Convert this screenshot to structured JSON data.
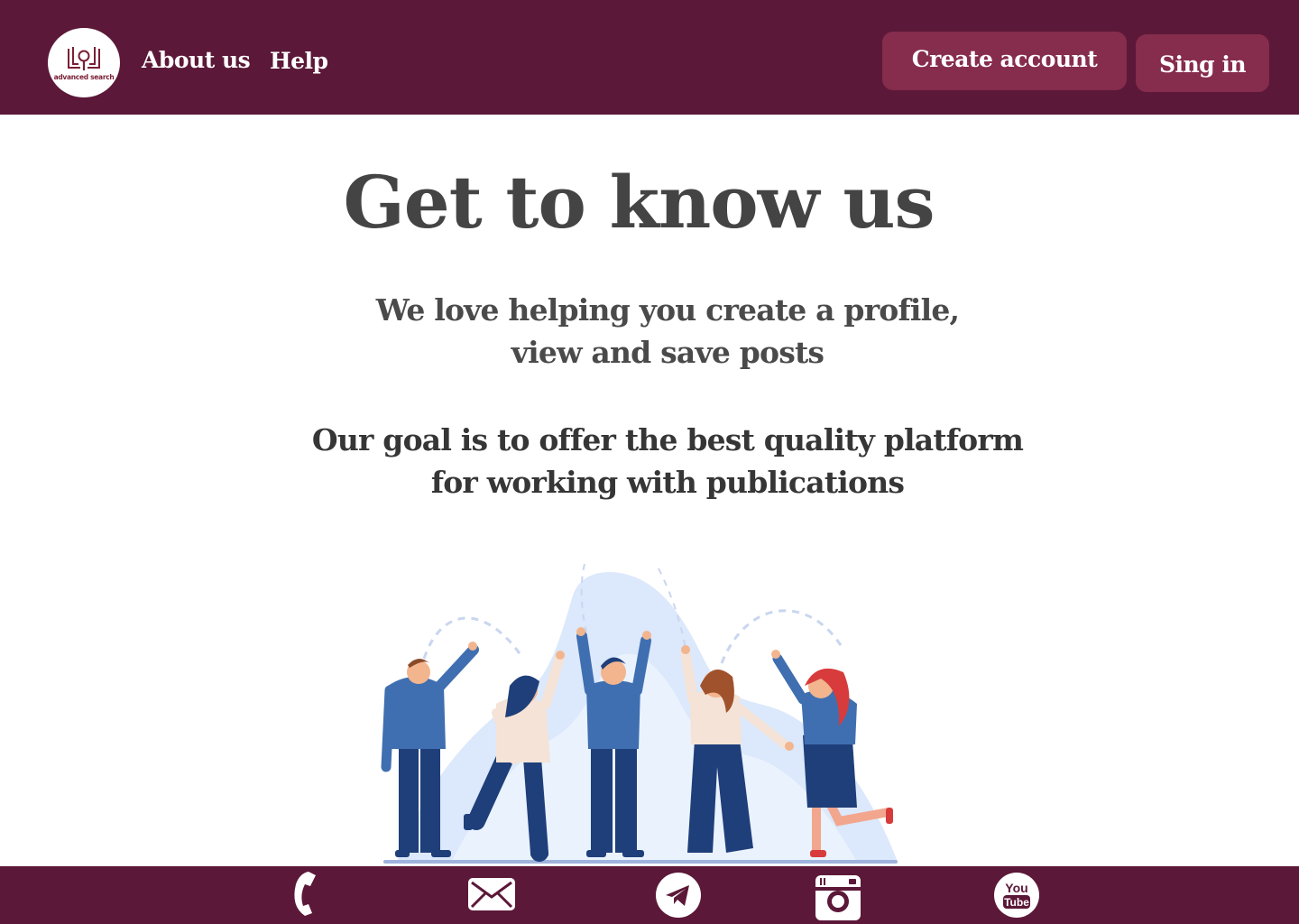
{
  "header": {
    "logo_text": "advanced search",
    "nav": {
      "about_label": "About us",
      "help_label": "Help"
    },
    "create_account_label": "Create account",
    "sign_in_label": "Sing in"
  },
  "main": {
    "title": "Get to know us",
    "paragraph_1": [
      "We love helping you create a profile,",
      "view and save posts"
    ],
    "paragraph_2": [
      "Our goal is to offer the best quality platform",
      "for working with publications"
    ]
  },
  "footer": {
    "icons": [
      "phone-icon",
      "mail-icon",
      "telegram-icon",
      "instagram-icon",
      "youtube-icon"
    ],
    "youtube_text": [
      "You",
      "Tube"
    ]
  },
  "colors": {
    "brand": "#5c1838",
    "button": "#862c4d",
    "text_dark": "#444444",
    "logo_accent": "#7a1f36"
  }
}
